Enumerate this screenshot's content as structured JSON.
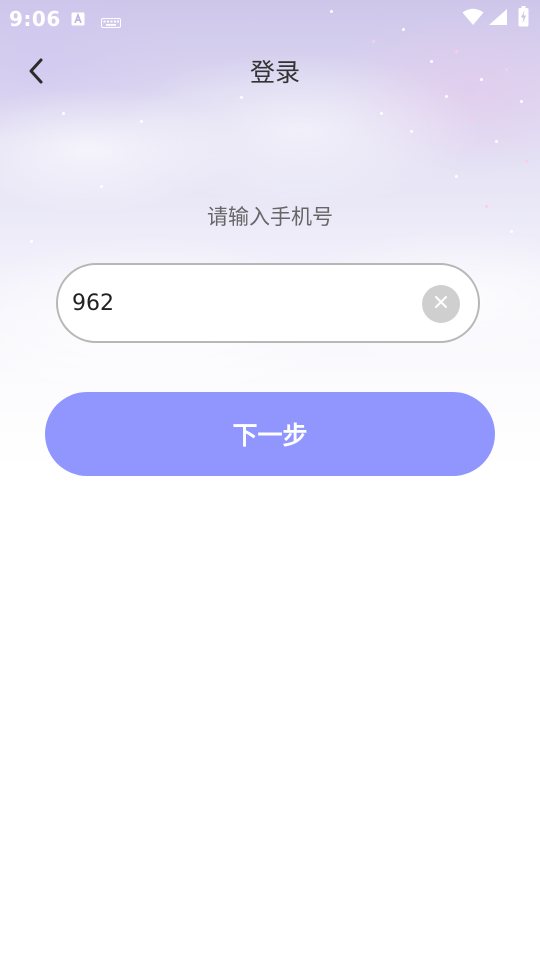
{
  "status_bar": {
    "time": "9:06",
    "icons": [
      "keyboard-a-icon",
      "keyboard-icon",
      "wifi-icon",
      "signal-icon",
      "battery-charging-icon"
    ]
  },
  "header": {
    "title": "登录",
    "back_icon": "chevron-left-icon"
  },
  "form": {
    "prompt": "请输入手机号",
    "phone_value": "962",
    "clear_icon": "close-icon",
    "next_label": "下一步"
  },
  "colors": {
    "accent": "#9096fe",
    "title_text": "#333333",
    "prompt_text": "#666666",
    "field_border": "#b7b7b7",
    "clear_bg": "#cfcfcf"
  }
}
